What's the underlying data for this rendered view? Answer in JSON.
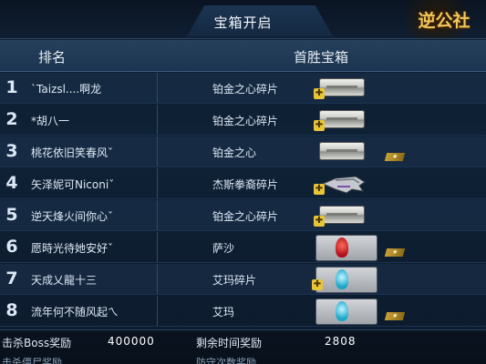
{
  "header": {
    "title": "宝箱开启",
    "logo_text": "逆公社",
    "col_rank": "排名",
    "col_reward": "首胜宝箱"
  },
  "rows": [
    {
      "rank": "1",
      "name": "`Taizsl....啊龙",
      "reward": "铂金之心碎片",
      "item": "platinum-plate",
      "s_badge": false
    },
    {
      "rank": "2",
      "name": "*胡八一",
      "reward": "铂金之心碎片",
      "item": "platinum-plate",
      "s_badge": false
    },
    {
      "rank": "3",
      "name": "桃花依旧笑春风ˇ",
      "reward": "铂金之心",
      "item": "platinum-plate",
      "s_badge": true
    },
    {
      "rank": "4",
      "name": "矢泽妮可Niconiˇ",
      "reward": "杰斯拳裔碎片",
      "item": "gauntlet",
      "s_badge": false
    },
    {
      "rank": "5",
      "name": "逆天烽火间你心ˇ",
      "reward": "铂金之心碎片",
      "item": "platinum-plate",
      "s_badge": false
    },
    {
      "rank": "6",
      "name": "愿時光待她安好ˇ",
      "reward": "萨沙",
      "item": "character-red",
      "s_badge": true
    },
    {
      "rank": "7",
      "name": "天成乂龍十三",
      "reward": "艾玛碎片",
      "item": "character-cyan",
      "s_badge": false
    },
    {
      "rank": "8",
      "name": "流年何不随风起ㄟ",
      "reward": "艾玛",
      "item": "character-cyan",
      "s_badge": true
    }
  ],
  "footer": {
    "boss_label": "击杀Boss奖励",
    "boss_value": "400000",
    "time_label": "剩余时间奖励",
    "time_value": "2808",
    "cut_left": "击杀僵尸奖励",
    "cut_right": "防守次数奖励"
  },
  "colors": {
    "gold_badge": "#e8c437",
    "logo": "#f0c75a",
    "header_bg": "#26405c"
  }
}
